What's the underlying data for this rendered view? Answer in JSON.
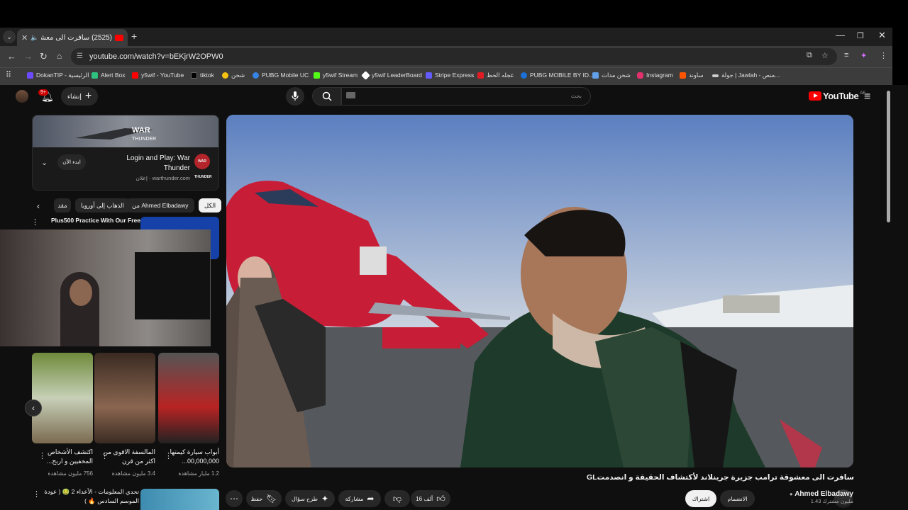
{
  "browser": {
    "tab_title": "(2525) سافرت الى معشوقة ر",
    "tab_close": "✕",
    "new_tab": "+",
    "url": "youtube.com/watch?v=bEKjrW2OPW0",
    "bookmarks": [
      {
        "label": "DokanTIP - الرئيسية",
        "color": "#6d4aff"
      },
      {
        "label": "Alert Box",
        "color": "#2ec27e"
      },
      {
        "label": "y5wif - YouTube",
        "color": "#ff0000"
      },
      {
        "label": "tiktok",
        "color": "#000000"
      },
      {
        "label": "شحن",
        "color": "#f5c211"
      },
      {
        "label": "PUBG Mobile UC",
        "color": "#3584e4"
      },
      {
        "label": "y5wif Stream",
        "color": "#53fc18"
      },
      {
        "label": "y5wif LeaderBoard",
        "color": "#ffffff"
      },
      {
        "label": "Stripe Express",
        "color": "#635bff"
      },
      {
        "label": "عجله الحظ",
        "color": "#e01b24"
      },
      {
        "label": "PUBG MOBILE BY ID...",
        "color": "#1c71d8"
      },
      {
        "label": "شحن مدات",
        "color": "#62a0ea"
      },
      {
        "label": "Instagram",
        "color": "#e1306c"
      },
      {
        "label": "ساوند",
        "color": "#ff5500"
      },
      {
        "label": "جولة | Jawlah - منص...",
        "color": "#cccccc"
      }
    ]
  },
  "youtube": {
    "logo_text": "YouTube",
    "country_code": "AE",
    "search_placeholder": "بحث",
    "create_label": "إنشاء",
    "notif_count": "9+",
    "ad": {
      "title": "Login and Play: War Thunder",
      "meta": "إعلان · warthunder.com",
      "cta": "ابدء الآن",
      "logo_text": "WAR THUNDER"
    },
    "chips": [
      "الكل",
      "من Ahmed Elbadawy",
      "الذهاب إلى أوروبا",
      "مقد"
    ],
    "pip_title": "Plus500 Practice With Our Free",
    "shorts": [
      {
        "caption": "أبواب سيارة كيمتها 00,000,000...",
        "views": "1.2 مليار مشاهدة"
      },
      {
        "caption": "المالسفة الاقوى من اكثر من قرن",
        "views": "3.4 مليون مشاهدة"
      },
      {
        "caption": "اكتشف الأشخاص المخفيين و اربح...",
        "views": "756 مليون مشاهدة"
      }
    ],
    "bottom_video_title": "تحدي المعلومات - الأعداء 2 🤢 ( عودة الموسم السادس 🔥 )",
    "video": {
      "title": "سافرت الى معشوقة ترامب جزيرة جرينلاند لأكتشاف الحقيقة و انصدمتGL",
      "channel": "Ahmed Elbadawy",
      "subscribers": "1.43 مليون مشترك",
      "join": "الانضمام",
      "subscribe": "اشتراك",
      "likes": "16 ألف",
      "share": "مشاركة",
      "ask": "طرح سؤال",
      "save": "حفظ"
    }
  }
}
